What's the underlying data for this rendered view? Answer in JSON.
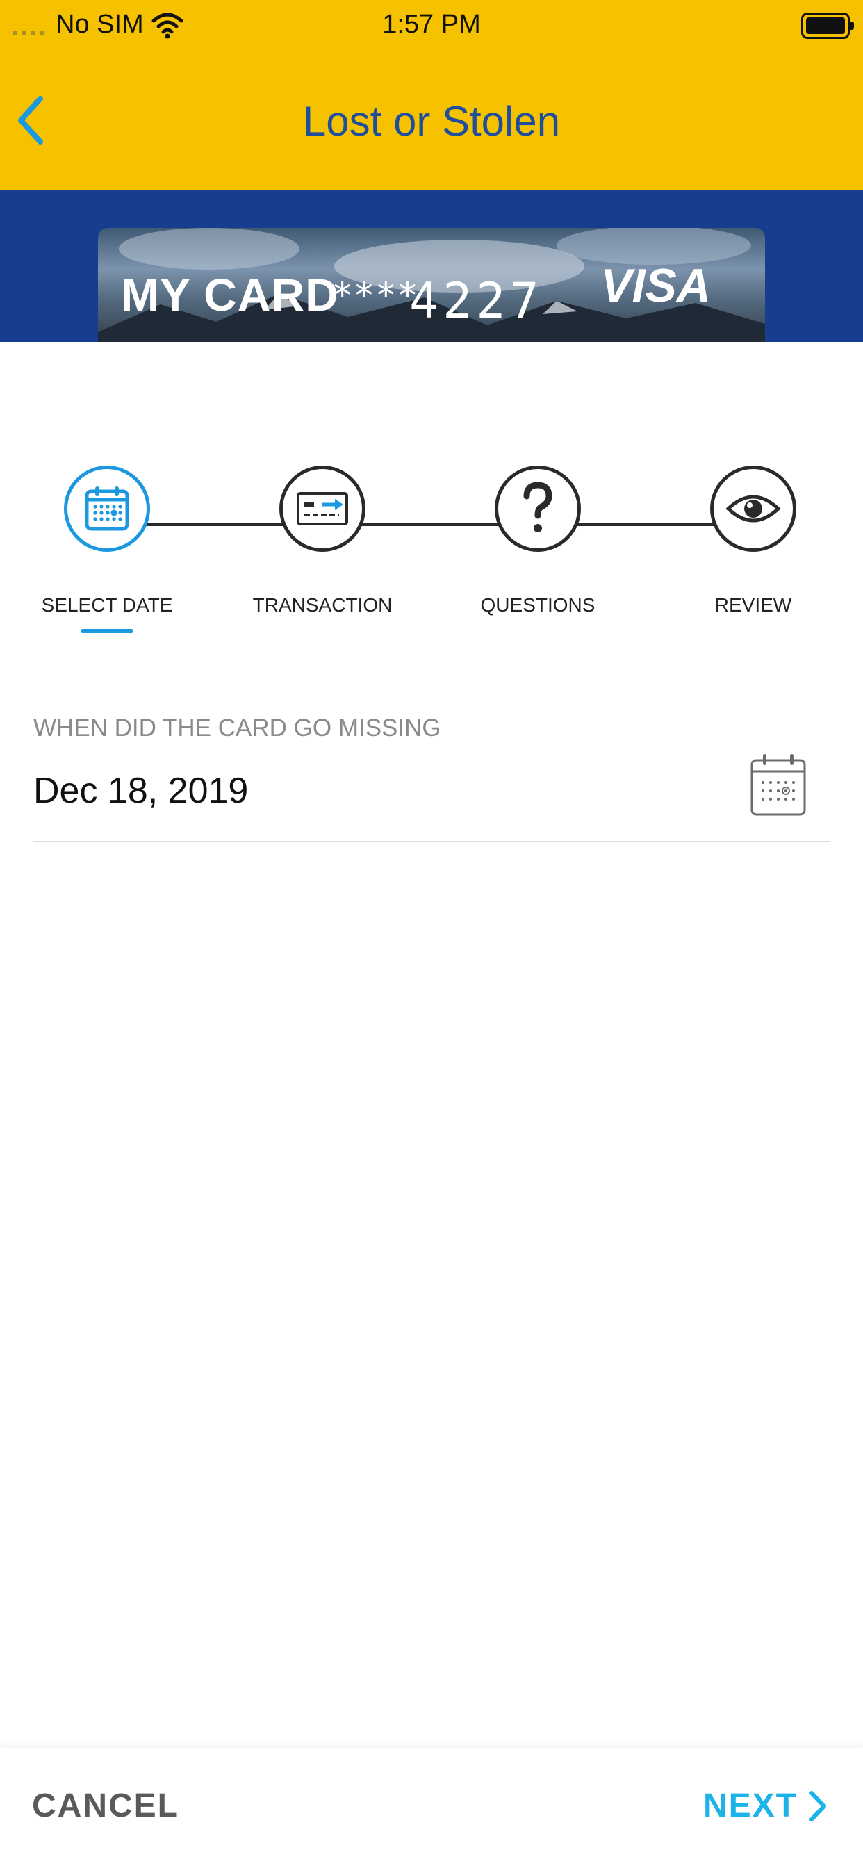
{
  "status_bar": {
    "carrier": "No SIM",
    "time": "1:57 PM"
  },
  "header": {
    "title": "Lost or Stolen",
    "back_icon": "chevron-left-icon"
  },
  "card": {
    "name": "MY CARD",
    "mask": "****",
    "last4": "4227",
    "brand": "VISA"
  },
  "steps": [
    {
      "label": "SELECT DATE",
      "icon": "calendar-icon",
      "active": true
    },
    {
      "label": "TRANSACTION",
      "icon": "card-transfer-icon",
      "active": false
    },
    {
      "label": "QUESTIONS",
      "icon": "question-mark-icon",
      "active": false
    },
    {
      "label": "REVIEW",
      "icon": "eye-icon",
      "active": false
    }
  ],
  "date_field": {
    "label": "WHEN DID THE CARD GO MISSING",
    "value": "Dec 18, 2019",
    "icon": "calendar-icon"
  },
  "footer": {
    "cancel_label": "CANCEL",
    "next_label": "NEXT"
  },
  "colors": {
    "header_bg": "#F6C200",
    "band_bg": "#163D8E",
    "accent": "#1B98E0",
    "title": "#1F4F9C",
    "next": "#1BB3EA"
  }
}
